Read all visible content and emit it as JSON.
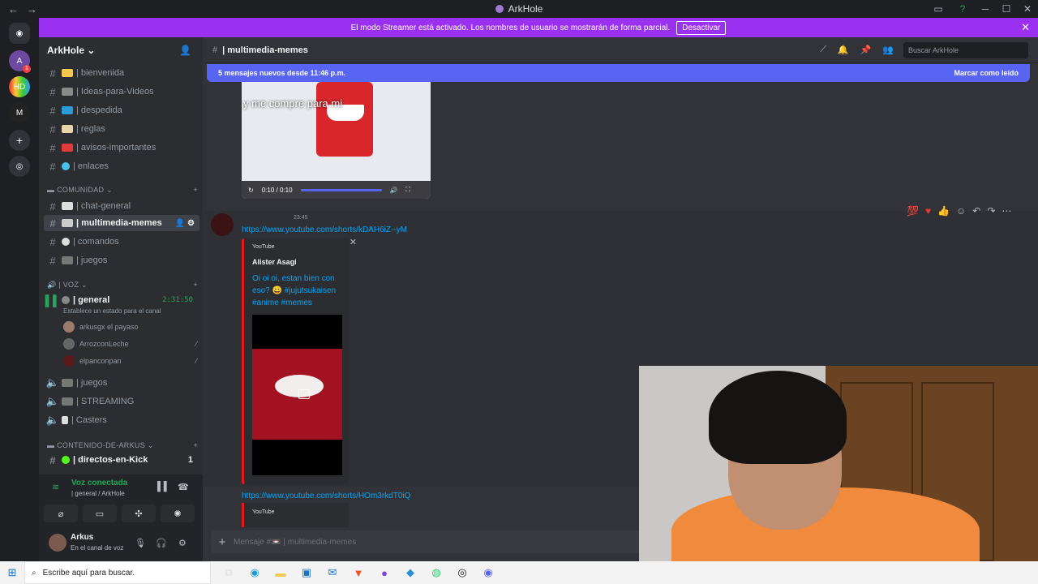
{
  "window": {
    "title": "ArkHole",
    "back": "←",
    "forward": "→",
    "min": "─",
    "max": "☐",
    "close": "✕"
  },
  "banner": {
    "text": "El modo Streamer está activado. Los nombres de usuario se mostrarán de forma parcial.",
    "button": "Desactivar",
    "close": "✕"
  },
  "server": {
    "name": "ArkHole",
    "chevron": "⌄"
  },
  "channels": {
    "c1": "| bienvenida",
    "c2": "| Ideas-para-Videos",
    "c3": "| despedida",
    "c4": "| reglas",
    "c5": "| avisos-importantes",
    "c6": "| enlaces",
    "cat_comunidad": "COMUNIDAD",
    "c7": "| chat-general",
    "c8": "| multimedia-memes",
    "c9": "| comandos",
    "c10": "| juegos",
    "cat_voz": "| VOZ",
    "voice_general": "| general",
    "voice_timer": "2:31:50",
    "voice_status": "Establece un estado para el canal",
    "voice_users": [
      "arkusgx el payaso",
      "ArrozconLeche",
      "elpanconpan"
    ],
    "v2": "| juegos",
    "v3": "| STREAMING",
    "v4": "| Casters",
    "cat_contenido": "CONTENIDO-DE-ARKUS",
    "c11": "| directos-en-Kick",
    "c11_badge": "1"
  },
  "voice_panel": {
    "connected": "Voz conectada",
    "location": "| general / ArkHole",
    "user": "Arkus",
    "status": "En el canal de voz"
  },
  "header": {
    "channel": "| multimedia-memes",
    "search_placeholder": "Buscar ArkHole"
  },
  "new_messages": {
    "text": "5 mensajes nuevos desde 11:46 p.m.",
    "mark": "Marcar como leído"
  },
  "video": {
    "caption": "y me compre para mi",
    "time": "0:10 / 0:10"
  },
  "message": {
    "time": "23:45",
    "link1": "https://www.youtube.com/shorts/kDAH6iZ--yM",
    "embed_provider": "YouTube",
    "embed_author": "Alister Asagi",
    "embed_desc": "Oi oi oi, estan bien con eso? 😀 #jujutsukaisen #anime #memes",
    "link2": "https://www.youtube.com/shorts/HOm3rkdT0iQ",
    "embed2_provider": "YouTube"
  },
  "composer": {
    "placeholder": "Mensaje #📼 | multimedia-memes"
  },
  "taskbar": {
    "search": "Escribe aquí para buscar."
  },
  "icons": {
    "start": "windows-icon",
    "discord": "discord-icon"
  }
}
